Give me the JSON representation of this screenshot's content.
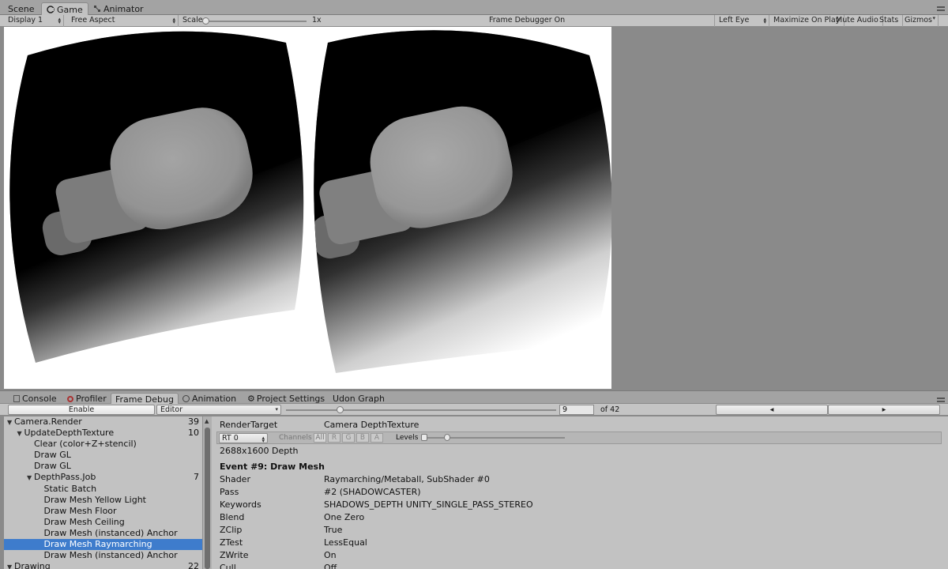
{
  "top_tabs": [
    {
      "label": "Scene",
      "icon": "scene-icon"
    },
    {
      "label": "Game",
      "icon": "game-controller-icon",
      "active": true
    },
    {
      "label": "Animator",
      "icon": "animator-icon"
    }
  ],
  "game_toolbar": {
    "display": "Display 1",
    "aspect": "Free Aspect",
    "scale_label": "Scale",
    "scale_value": "1x",
    "center_status": "Frame Debugger On",
    "eye": "Left Eye",
    "maximize": "Maximize On Play",
    "mute": "Mute Audio",
    "stats": "Stats",
    "gizmos": "Gizmos"
  },
  "bottom_tabs": [
    {
      "label": "Console",
      "icon": "console-icon"
    },
    {
      "label": "Profiler",
      "icon": "profiler-icon"
    },
    {
      "label": "Frame Debug",
      "active": true
    },
    {
      "label": "Animation",
      "icon": "animation-icon"
    },
    {
      "label": "Project Settings",
      "icon": "gear-icon"
    },
    {
      "label": "Udon Graph"
    }
  ],
  "frame_debug_toolbar": {
    "enable": "Enable",
    "source": "Editor",
    "event_index": "9",
    "event_total": "of 42",
    "event_fraction": 0.2
  },
  "tree": [
    {
      "label": "Camera.Render",
      "count": "39",
      "depth": 0,
      "expanded": true
    },
    {
      "label": "UpdateDepthTexture",
      "count": "10",
      "depth": 1,
      "expanded": true
    },
    {
      "label": "Clear (color+Z+stencil)",
      "count": "",
      "depth": 2
    },
    {
      "label": "Draw GL",
      "count": "",
      "depth": 2
    },
    {
      "label": "Draw GL",
      "count": "",
      "depth": 2
    },
    {
      "label": "DepthPass.Job",
      "count": "7",
      "depth": 2,
      "expanded": true
    },
    {
      "label": "Static Batch",
      "count": "",
      "depth": 3
    },
    {
      "label": "Draw Mesh Yellow Light",
      "count": "",
      "depth": 3
    },
    {
      "label": "Draw Mesh Floor",
      "count": "",
      "depth": 3
    },
    {
      "label": "Draw Mesh Ceiling",
      "count": "",
      "depth": 3
    },
    {
      "label": "Draw Mesh (instanced) Anchor",
      "count": "",
      "depth": 3
    },
    {
      "label": "Draw Mesh Raymarching",
      "count": "",
      "depth": 3,
      "selected": true
    },
    {
      "label": "Draw Mesh (instanced) Anchor",
      "count": "",
      "depth": 3
    },
    {
      "label": "Drawing",
      "count": "22",
      "depth": 0,
      "expanded": true
    }
  ],
  "detail": {
    "render_target_label": "RenderTarget",
    "render_target_value": "Camera DepthTexture",
    "rt_select": "RT 0",
    "channels_label": "Channels",
    "channels": [
      "All",
      "R",
      "G",
      "B",
      "A"
    ],
    "levels_label": "Levels",
    "resolution": "2688x1600 Depth",
    "event_title": "Event #9: Draw Mesh",
    "properties": [
      {
        "key": "Shader",
        "value": "Raymarching/Metaball, SubShader #0"
      },
      {
        "key": "Pass",
        "value": "#2 (SHADOWCASTER)"
      },
      {
        "key": "Keywords",
        "value": "SHADOWS_DEPTH UNITY_SINGLE_PASS_STEREO"
      },
      {
        "key": "Blend",
        "value": "One Zero"
      },
      {
        "key": "ZClip",
        "value": "True"
      },
      {
        "key": "ZTest",
        "value": "LessEqual"
      },
      {
        "key": "ZWrite",
        "value": "On"
      },
      {
        "key": "Cull",
        "value": "Off"
      }
    ]
  }
}
